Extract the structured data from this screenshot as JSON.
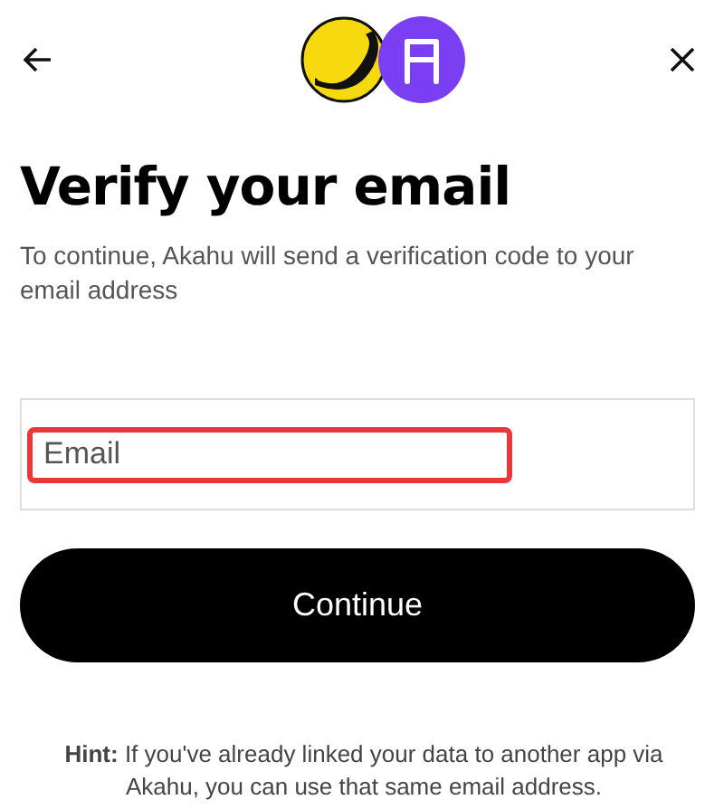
{
  "title": "Verify your email",
  "subtitle": "To continue, Akahu will send a verification code to your email address",
  "email_field": {
    "placeholder": "Email",
    "highlighted": true
  },
  "continue_button": "Continue",
  "hint": "**Hint:** If you've already linked your data to another app via Akahu, you can use that same email address."
}
